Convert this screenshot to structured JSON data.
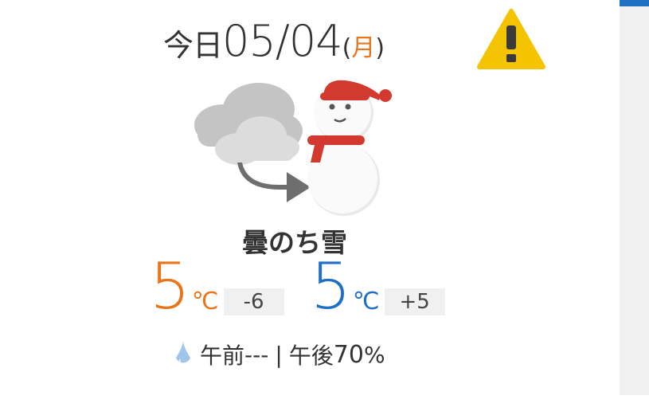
{
  "header": {
    "prefix": "今日",
    "date": "05/04",
    "paren_open": "(",
    "day_of_week": "月",
    "paren_close": ")"
  },
  "icons": {
    "warning": "warning-icon",
    "weather": "cloudy-then-snow-icon",
    "rain": "raindrop-icon"
  },
  "forecast": {
    "text": "曇のち雪"
  },
  "temperature": {
    "high": {
      "value": "5",
      "unit": "℃",
      "diff": "-6"
    },
    "low": {
      "value": "5",
      "unit": "℃",
      "diff": "+5"
    }
  },
  "precipitation": {
    "morning_label": "午前",
    "morning_value": "---",
    "separator": "|",
    "afternoon_label": "午後",
    "afternoon_value": "70",
    "unit": "%"
  },
  "colors": {
    "high": "#e8751a",
    "low": "#1f6fc2",
    "warning": "#f5c400",
    "accent": "#1f6fc2"
  }
}
